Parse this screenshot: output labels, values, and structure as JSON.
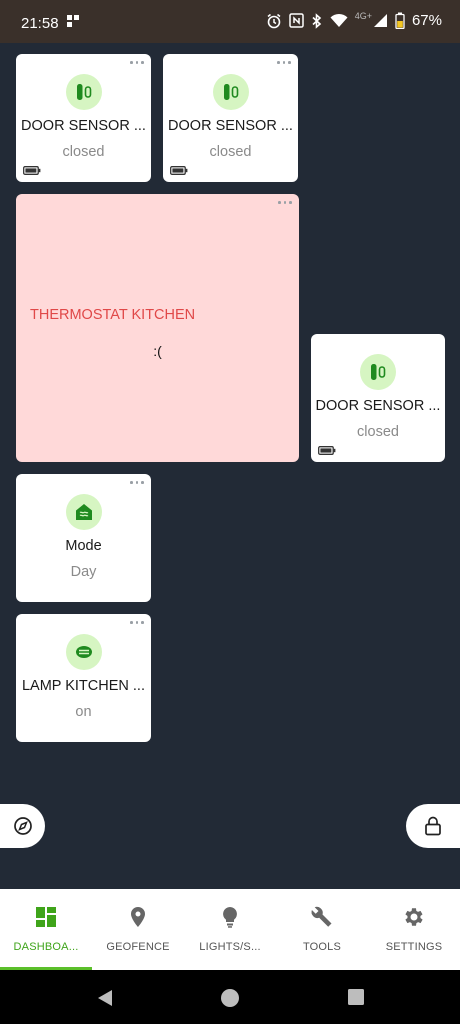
{
  "status_bar": {
    "time": "21:58",
    "network_label": "4G+",
    "battery_percent": "67%",
    "icons": [
      "alarm-icon",
      "nfc-icon",
      "bluetooth-icon",
      "wifi-icon",
      "cell-signal-icon",
      "battery-icon"
    ]
  },
  "tiles": {
    "door_sensor_1": {
      "title": "DOOR SENSOR ...",
      "value": "closed",
      "icon": "door-sensor-icon"
    },
    "door_sensor_2": {
      "title": "DOOR SENSOR ...",
      "value": "closed",
      "icon": "door-sensor-icon"
    },
    "thermostat": {
      "title": "THERMOSTAT KITCHEN",
      "error_text": ":("
    },
    "door_sensor_3": {
      "title": "DOOR SENSOR ...",
      "value": "closed",
      "icon": "door-sensor-icon"
    },
    "mode": {
      "title": "Mode",
      "value": "Day",
      "icon": "home-mode-icon"
    },
    "lamp": {
      "title": "LAMP KITCHEN ...",
      "value": "on",
      "icon": "lamp-icon"
    }
  },
  "fabs": {
    "left_icon": "compass-icon",
    "right_icon": "lock-icon"
  },
  "bottom_nav": {
    "active": "dashboard",
    "items": [
      {
        "label": "DASHBOA...",
        "icon": "dashboard-icon"
      },
      {
        "label": "GEOFENCE",
        "icon": "location-pin-icon"
      },
      {
        "label": "LIGHTS/S...",
        "icon": "light-bulb-icon"
      },
      {
        "label": "TOOLS",
        "icon": "wrench-icon"
      },
      {
        "label": "SETTINGS",
        "icon": "gear-icon"
      }
    ]
  },
  "colors": {
    "background": "#222a36",
    "accent": "#3fa41a",
    "icon_bg": "#d6f5c2",
    "error_bg": "#ffd9d9",
    "error_text": "#e04848"
  }
}
